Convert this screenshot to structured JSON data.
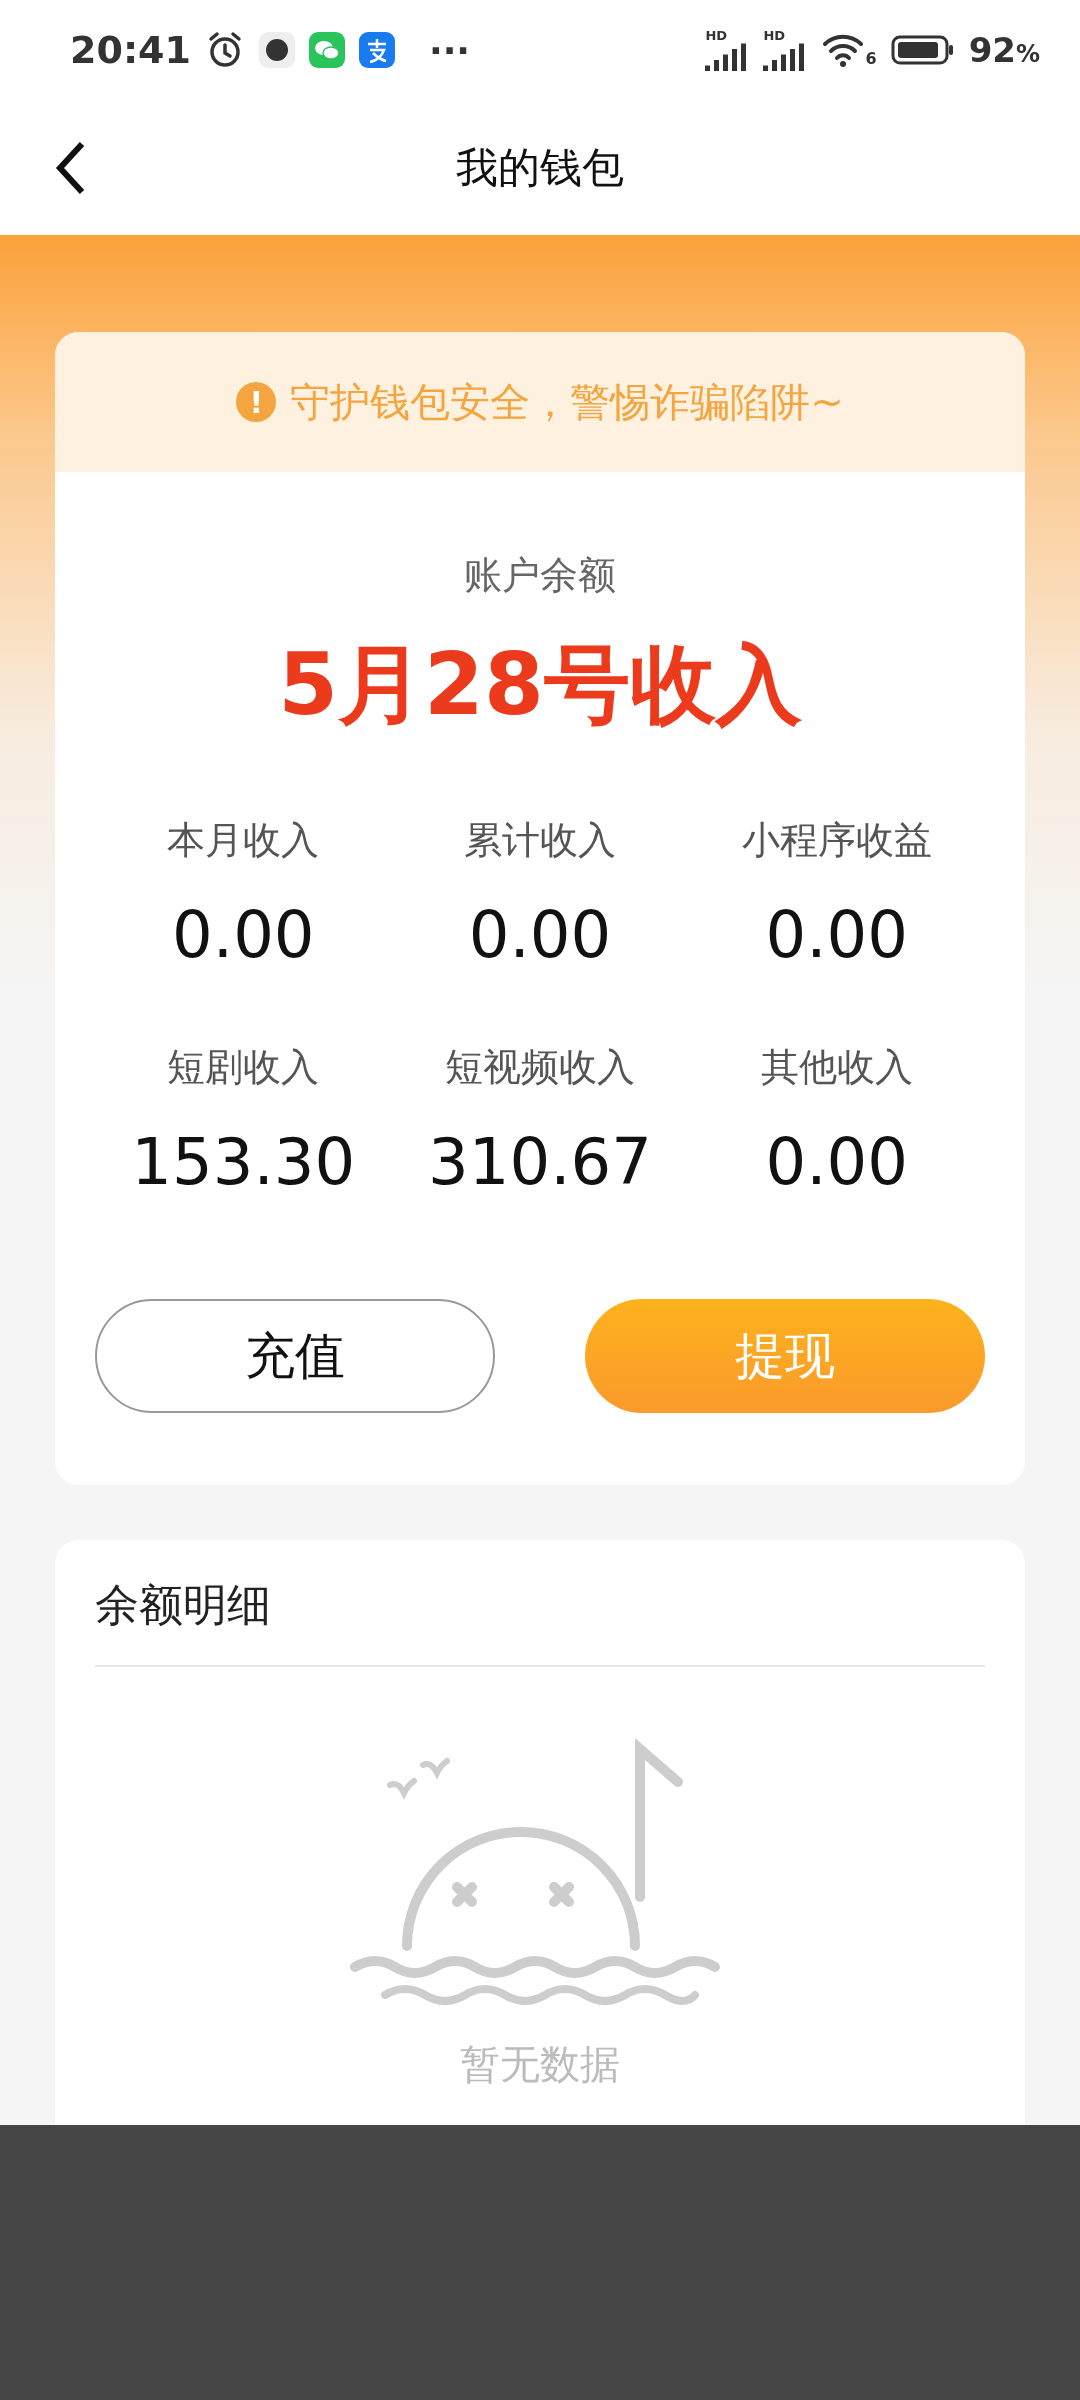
{
  "status_bar": {
    "time": "20:41",
    "more": "···",
    "signal_labels": [
      "HD",
      "HD"
    ],
    "wifi_label": "6",
    "battery": "92",
    "battery_unit": "%"
  },
  "header": {
    "title": "我的钱包"
  },
  "notice": {
    "icon": "!",
    "text": "守护钱包安全，警惕诈骗陷阱~"
  },
  "balance": {
    "label": "账户余额",
    "overlay": "5月28号收入"
  },
  "stats": [
    {
      "label": "本月收入",
      "value": "0.00"
    },
    {
      "label": "累计收入",
      "value": "0.00"
    },
    {
      "label": "小程序收益",
      "value": "0.00"
    },
    {
      "label": "短剧收入",
      "value": "153.30"
    },
    {
      "label": "短视频收入",
      "value": "310.67"
    },
    {
      "label": "其他收入",
      "value": "0.00"
    }
  ],
  "buttons": [
    {
      "label": "充值",
      "kind": "outline"
    },
    {
      "label": "提现",
      "kind": "primary"
    }
  ],
  "details": {
    "title": "余额明细",
    "empty_text": "暂无数据"
  }
}
